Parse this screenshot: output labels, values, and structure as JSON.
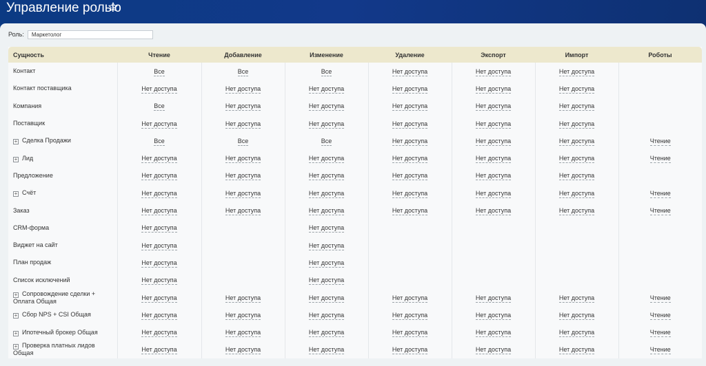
{
  "page": {
    "title": "Управление ролью"
  },
  "role": {
    "label": "Роль:",
    "value": "Маркетолог"
  },
  "table": {
    "columns": [
      "Сущность",
      "Чтение",
      "Добавление",
      "Изменение",
      "Удаление",
      "Экспорт",
      "Импорт",
      "Роботы"
    ],
    "rows": [
      {
        "entity": "Контакт",
        "expandable": false,
        "values": [
          "Все",
          "Все",
          "Все",
          "Нет доступа",
          "Нет доступа",
          "Нет доступа",
          ""
        ]
      },
      {
        "entity": "Контакт поставщика",
        "expandable": false,
        "values": [
          "Нет доступа",
          "Нет доступа",
          "Нет доступа",
          "Нет доступа",
          "Нет доступа",
          "Нет доступа",
          ""
        ]
      },
      {
        "entity": "Компания",
        "expandable": false,
        "values": [
          "Все",
          "Нет доступа",
          "Нет доступа",
          "Нет доступа",
          "Нет доступа",
          "Нет доступа",
          ""
        ]
      },
      {
        "entity": "Поставщик",
        "expandable": false,
        "values": [
          "Нет доступа",
          "Нет доступа",
          "Нет доступа",
          "Нет доступа",
          "Нет доступа",
          "Нет доступа",
          ""
        ]
      },
      {
        "entity": "Сделка Продажи",
        "expandable": true,
        "values": [
          "Все",
          "Все",
          "Все",
          "Нет доступа",
          "Нет доступа",
          "Нет доступа",
          "Чтение"
        ]
      },
      {
        "entity": "Лид",
        "expandable": true,
        "values": [
          "Нет доступа",
          "Нет доступа",
          "Нет доступа",
          "Нет доступа",
          "Нет доступа",
          "Нет доступа",
          "Чтение"
        ]
      },
      {
        "entity": "Предложение",
        "expandable": false,
        "values": [
          "Нет доступа",
          "Нет доступа",
          "Нет доступа",
          "Нет доступа",
          "Нет доступа",
          "Нет доступа",
          ""
        ]
      },
      {
        "entity": "Счёт",
        "expandable": true,
        "values": [
          "Нет доступа",
          "Нет доступа",
          "Нет доступа",
          "Нет доступа",
          "Нет доступа",
          "Нет доступа",
          "Чтение"
        ]
      },
      {
        "entity": "Заказ",
        "expandable": false,
        "values": [
          "Нет доступа",
          "Нет доступа",
          "Нет доступа",
          "Нет доступа",
          "Нет доступа",
          "Нет доступа",
          "Чтение"
        ]
      },
      {
        "entity": "CRM-форма",
        "expandable": false,
        "values": [
          "Нет доступа",
          "",
          "Нет доступа",
          "",
          "",
          "",
          ""
        ]
      },
      {
        "entity": "Виджет на сайт",
        "expandable": false,
        "values": [
          "Нет доступа",
          "",
          "Нет доступа",
          "",
          "",
          "",
          ""
        ]
      },
      {
        "entity": "План продаж",
        "expandable": false,
        "values": [
          "Нет доступа",
          "",
          "Нет доступа",
          "",
          "",
          "",
          ""
        ]
      },
      {
        "entity": "Список исключений",
        "expandable": false,
        "values": [
          "Нет доступа",
          "",
          "Нет доступа",
          "",
          "",
          "",
          ""
        ]
      },
      {
        "entity": "Сопровождение сделки + Оплата Общая",
        "expandable": true,
        "values": [
          "Нет доступа",
          "Нет доступа",
          "Нет доступа",
          "Нет доступа",
          "Нет доступа",
          "Нет доступа",
          "Чтение"
        ]
      },
      {
        "entity": "Сбор NPS + CSI Общая",
        "expandable": true,
        "values": [
          "Нет доступа",
          "Нет доступа",
          "Нет доступа",
          "Нет доступа",
          "Нет доступа",
          "Нет доступа",
          "Чтение"
        ]
      },
      {
        "entity": "Ипотечный брокер Общая",
        "expandable": true,
        "values": [
          "Нет доступа",
          "Нет доступа",
          "Нет доступа",
          "Нет доступа",
          "Нет доступа",
          "Нет доступа",
          "Чтение"
        ]
      },
      {
        "entity": "Проверка платных лидов Общая",
        "expandable": true,
        "values": [
          "Нет доступа",
          "Нет доступа",
          "Нет доступа",
          "Нет доступа",
          "Нет доступа",
          "Нет доступа",
          "Чтение"
        ]
      }
    ]
  }
}
